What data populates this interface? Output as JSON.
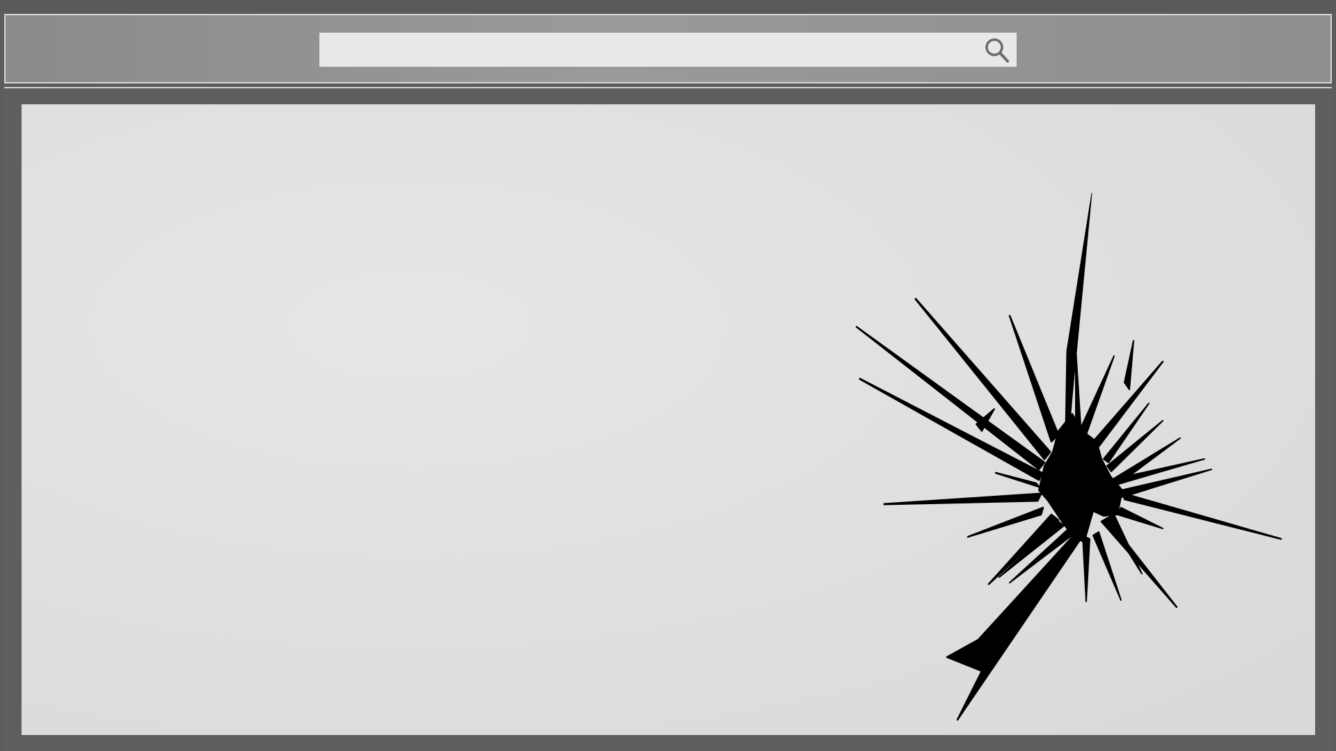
{
  "browser": {
    "search": {
      "value": "",
      "placeholder": "",
      "icon": "search-icon"
    }
  },
  "viewport": {
    "state": "cracked-screen",
    "crack_icon": "shattered-glass-icon"
  },
  "colors": {
    "frame": "#5c5c5c",
    "toolbar": "#8f8f8f",
    "search_box": "#e8e8e8",
    "viewport": "#e0e0e0",
    "crack": "#000000"
  }
}
